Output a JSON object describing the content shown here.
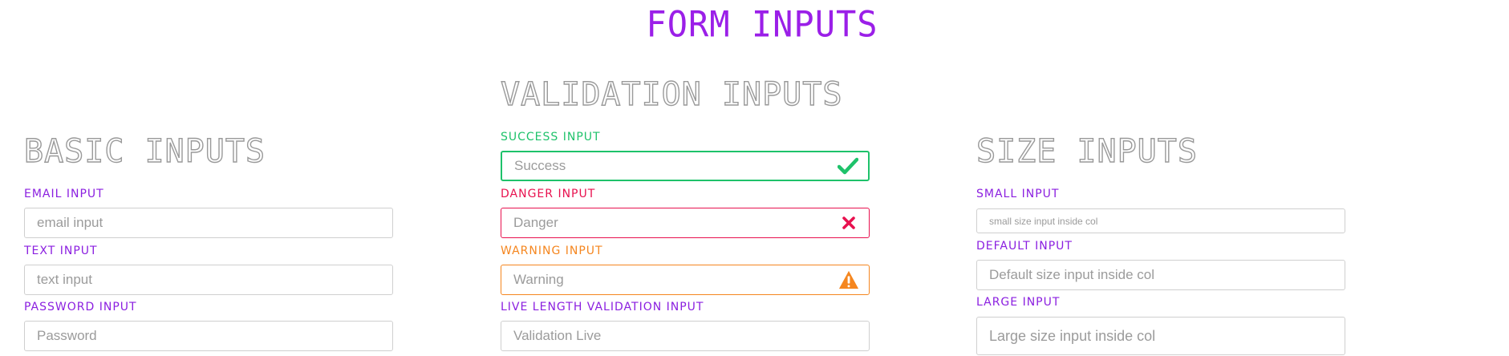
{
  "page": {
    "title": "FORM INPUTS"
  },
  "basic": {
    "title": "BASIC INPUTS",
    "email": {
      "label": "EMAIL INPUT",
      "placeholder": "email input"
    },
    "text": {
      "label": "TEXT INPUT",
      "placeholder": "text input"
    },
    "password": {
      "label": "PASSWORD INPUT",
      "placeholder": "Password"
    }
  },
  "validation": {
    "title": "VALIDATION INPUTS",
    "success": {
      "label": "SUCCESS INPUT",
      "placeholder": "Success",
      "color": "#1ec26a",
      "icon": "checkmark-icon"
    },
    "danger": {
      "label": "DANGER INPUT",
      "placeholder": "Danger",
      "color": "#e8114f",
      "icon": "x-icon"
    },
    "warning": {
      "label": "WARNING INPUT",
      "placeholder": "Warning",
      "color": "#f5861f",
      "icon": "warning-triangle-icon"
    },
    "live": {
      "label": "LIVE LENGTH VALIDATION INPUT",
      "placeholder": "Validation Live"
    }
  },
  "size": {
    "title": "SIZE INPUTS",
    "small": {
      "label": "SMALL INPUT",
      "placeholder": "small size input inside col"
    },
    "default": {
      "label": "DEFAULT INPUT",
      "placeholder": "Default size input inside col"
    },
    "large": {
      "label": "LARGE INPUT",
      "placeholder": "Large size input inside col"
    }
  },
  "colors": {
    "accent": "#8b1fe0",
    "title_outline": "#9a9a9a",
    "border": "#cfcfcf"
  }
}
